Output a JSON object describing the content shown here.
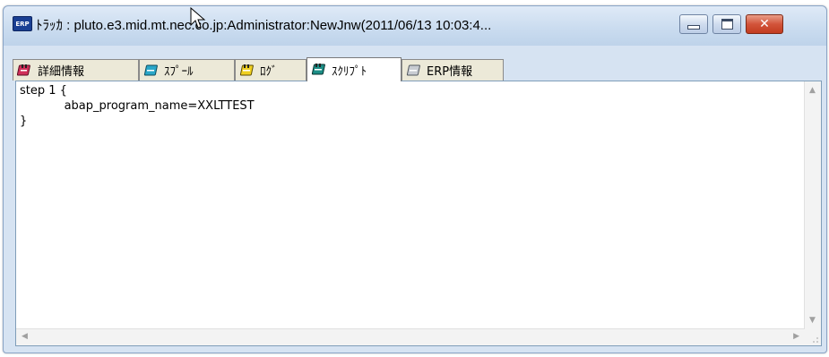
{
  "window": {
    "icon_text": "ERP",
    "title": "ﾄﾗｯｶ : pluto.e3.mid.mt.nec.co.jp:Administrator:NewJnw(2011/06/13 10:03:4..."
  },
  "titlebar_buttons": {
    "minimize": "minimize-icon",
    "maximize": "maximize-icon",
    "close_glyph": "✕"
  },
  "tabs": [
    {
      "label": "詳細情報",
      "icon": "notebook-icon",
      "active": false
    },
    {
      "label": "ｽﾌﾟｰﾙ",
      "icon": "notebook-icon",
      "active": false
    },
    {
      "label": "ﾛｸﾞ",
      "icon": "notebook-icon",
      "active": false
    },
    {
      "label": "ｽｸﾘﾌﾟﾄ",
      "icon": "notebook-icon",
      "active": true
    },
    {
      "label": "ERP情報",
      "icon": "notebook-icon",
      "active": false
    }
  ],
  "script_lines": [
    "step 1 {",
    "            abap_program_name=XXLTTEST",
    "}"
  ],
  "colors": {
    "tab_icon_red": "#d0305a",
    "tab_icon_cyan": "#2aa7c9",
    "tab_icon_yellow": "#f0d020",
    "tab_icon_teal": "#1c8e86",
    "tab_icon_gray": "#9aa3ad"
  }
}
